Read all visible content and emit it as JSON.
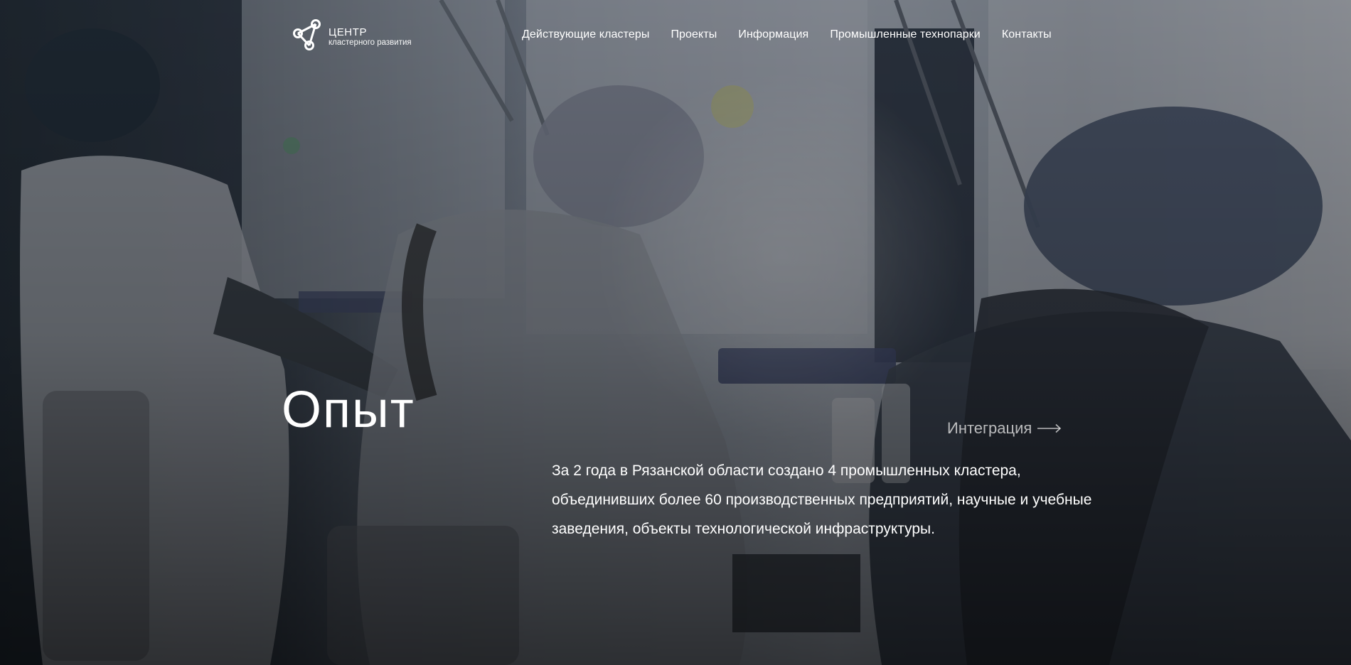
{
  "header": {
    "logo": {
      "title": "ЦЕНТР",
      "subtitle": "кластерного развития",
      "icon": "network-triangle-icon"
    },
    "nav": [
      {
        "label": "Действующие кластеры"
      },
      {
        "label": "Проекты"
      },
      {
        "label": "Информация"
      },
      {
        "label": "Промышленные технопарки"
      },
      {
        "label": "Контакты"
      }
    ]
  },
  "hero": {
    "title": "Опыт",
    "link": {
      "label": "Интеграция",
      "icon": "arrow-right-icon"
    },
    "description": "За 2 года в Рязанской области создано 4 промышленных кластера, объединивших более 60 производственных предприятий, научные и учебные заведения, объекты технологической инфраструктуры."
  },
  "colors": {
    "text": "#ffffff",
    "muted_link": "#e1e1e1",
    "overlay": "#1c232b"
  }
}
